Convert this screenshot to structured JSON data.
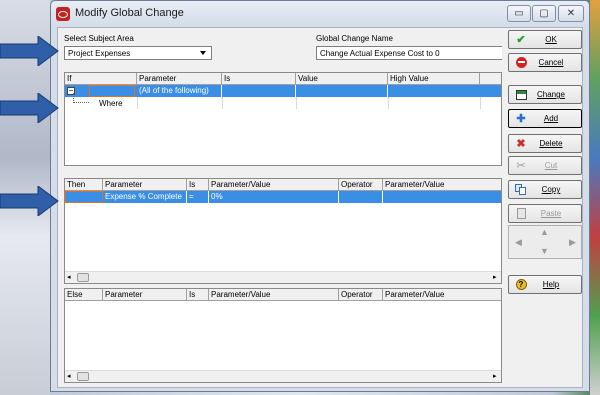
{
  "window": {
    "title": "Modify Global Change",
    "minimize_glyph": "▭",
    "maximize_glyph": "▢",
    "close_glyph": "✕"
  },
  "subject_area": {
    "label": "Select Subject Area",
    "value": "Project Expenses"
  },
  "global_change_name": {
    "label": "Global Change Name",
    "value": "Change Actual Expense Cost to 0"
  },
  "if_grid": {
    "headers": [
      "If",
      "Parameter",
      "Is",
      "Value",
      "High Value"
    ],
    "rows": [
      {
        "expander": "−",
        "parameter": "(All of the following)"
      },
      {
        "where_label": "Where"
      }
    ]
  },
  "then_grid": {
    "headers": [
      "Then",
      "Parameter",
      "Is",
      "Parameter/Value",
      "Operator",
      "Parameter/Value"
    ],
    "rows": [
      {
        "parameter": "Expense % Complete",
        "is": "=",
        "value": "0%"
      }
    ]
  },
  "else_grid": {
    "headers": [
      "Else",
      "Parameter",
      "Is",
      "Parameter/Value",
      "Operator",
      "Parameter/Value"
    ]
  },
  "buttons": {
    "ok": "OK",
    "cancel": "Cancel",
    "change": "Change",
    "add": "Add",
    "delete": "Delete",
    "cut": "Cut",
    "copy": "Copy",
    "paste": "Paste",
    "help": "Help"
  },
  "icons": {
    "ok": "checkmark-icon",
    "cancel": "no-entry-icon",
    "change": "change-icon",
    "add": "plus-icon",
    "delete": "x-icon",
    "cut": "scissors-icon",
    "copy": "copy-icon",
    "paste": "paste-icon",
    "help": "help-icon"
  },
  "colors": {
    "selection": "#3a8ee6",
    "callout_arrow": "#2f5fa8",
    "title_icon": "#c82020"
  }
}
